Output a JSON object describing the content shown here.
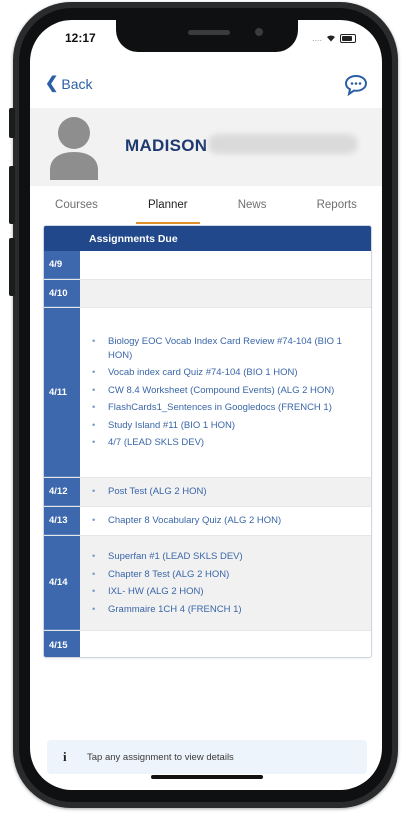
{
  "status_bar": {
    "time": "12:17",
    "signal": "....",
    "wifi_icon": "wifi-icon",
    "battery_icon": "battery-icon"
  },
  "nav": {
    "back_label": "Back",
    "chat_icon": "chat-bubble-icon"
  },
  "profile": {
    "name": "MADISON",
    "avatar_icon": "person-avatar-icon"
  },
  "tabs": [
    {
      "label": "Courses",
      "active": false
    },
    {
      "label": "Planner",
      "active": true
    },
    {
      "label": "News",
      "active": false
    },
    {
      "label": "Reports",
      "active": false
    }
  ],
  "table": {
    "header": "Assignments Due",
    "rows": [
      {
        "date": "4/9",
        "items": []
      },
      {
        "date": "4/10",
        "items": []
      },
      {
        "date": "4/11",
        "items": [
          "Biology EOC Vocab Index Card Review #74-104 (BIO 1 HON)",
          "Vocab index card Quiz #74-104 (BIO 1 HON)",
          "CW 8.4 Worksheet (Compound Events) (ALG 2 HON)",
          "FlashCards1_Sentences in Googledocs (FRENCH 1)",
          "Study Island #11 (BIO 1 HON)",
          "4/7 (LEAD SKLS DEV)"
        ]
      },
      {
        "date": "4/12",
        "items": [
          "Post Test (ALG 2 HON)"
        ]
      },
      {
        "date": "4/13",
        "items": [
          "Chapter 8 Vocabulary Quiz (ALG 2 HON)"
        ]
      },
      {
        "date": "4/14",
        "items": [
          "Superfan #1 (LEAD SKLS DEV)",
          "Chapter 8 Test (ALG 2 HON)",
          "IXL- HW (ALG 2 HON)",
          "Grammaire 1CH 4 (FRENCH 1)"
        ]
      },
      {
        "date": "4/15",
        "items": []
      }
    ]
  },
  "footer": {
    "hint": "Tap any assignment to view details",
    "info_icon": "info-icon"
  },
  "colors": {
    "header_navy": "#20488a",
    "date_blue": "#3d68ad",
    "link_blue": "#3a66a8",
    "tab_accent": "#e0922c",
    "name_navy": "#1e3a70"
  }
}
